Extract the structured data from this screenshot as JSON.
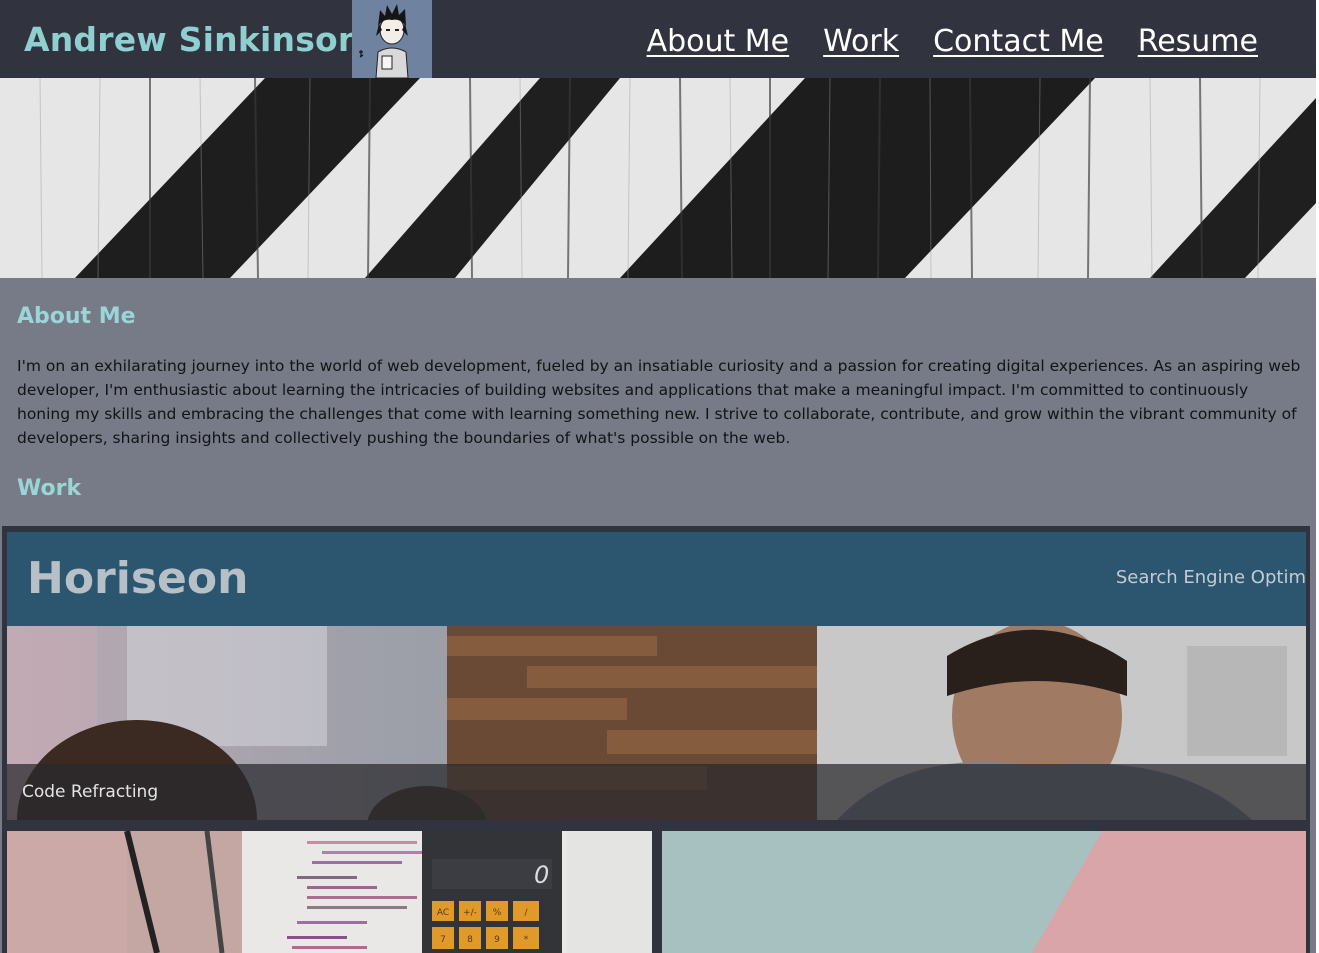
{
  "header": {
    "site_name": "Andrew Sinkinson",
    "nav": [
      {
        "label": "About Me"
      },
      {
        "label": "Work"
      },
      {
        "label": "Contact Me"
      },
      {
        "label": "Resume"
      }
    ]
  },
  "about": {
    "heading": "About Me",
    "body": "I'm on an exhilarating journey into the world of web development, fueled by an insatiable curiosity and a passion for creating digital experiences. As an aspiring web developer, I'm enthusiastic about learning the intricacies of building websites and applications that make a meaningful impact. I'm committed to continuously honing my skills and embracing the challenges that come with learning something new. I strive to collaborate, contribute, and grow within the vibrant community of developers, sharing insights and collectively pushing the boundaries of what's possible on the web."
  },
  "work": {
    "heading": "Work",
    "featured": {
      "mock_brand": "Horiseon",
      "mock_nav": "Search Engine Optim",
      "label": "Code Refracting"
    },
    "calculator_display": "0",
    "calculator_keys": [
      "AC",
      "+/-",
      "%",
      "/",
      "7",
      "8",
      "9",
      "*"
    ]
  },
  "colors": {
    "header_bg": "#31343f",
    "accent_teal": "#8fcfcf",
    "page_bg": "#777a87",
    "mock_header_bg": "#2c5670",
    "calculator_key": "#e09a2a"
  }
}
